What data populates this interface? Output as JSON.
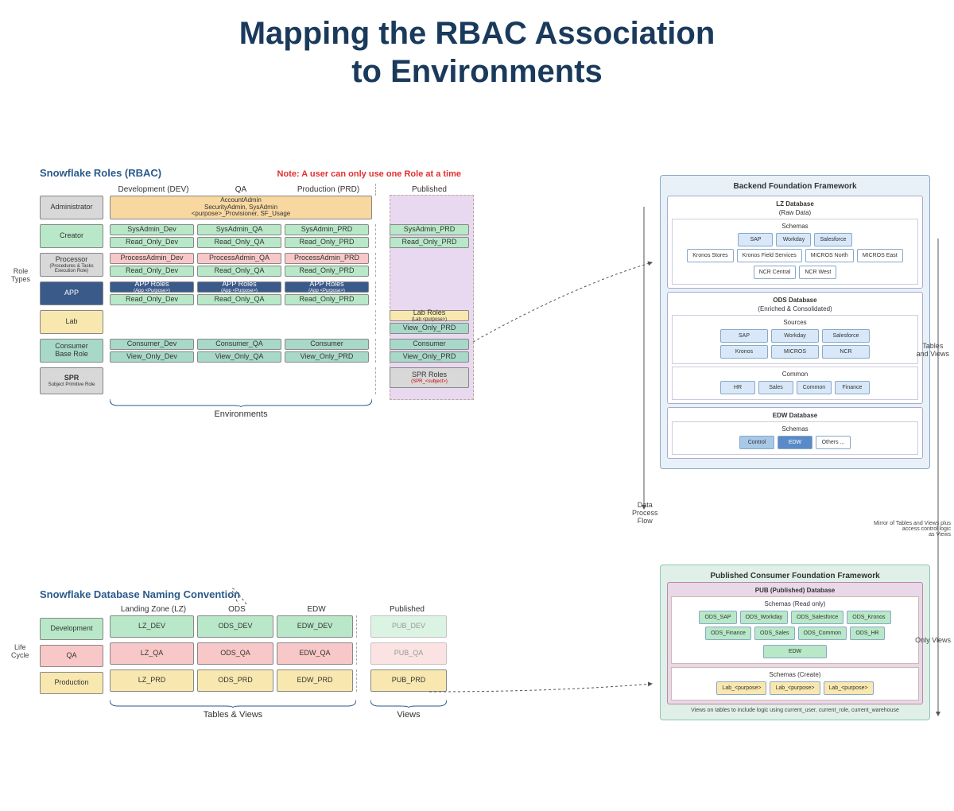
{
  "title_line1": "Mapping the RBAC Association",
  "title_line2": "to Environments",
  "rbac": {
    "header": "Snowflake Roles (RBAC)",
    "note": "Note: A user can only use one Role at a time",
    "col_dev": "Development (DEV)",
    "col_qa": "QA",
    "col_prd": "Production (PRD)",
    "col_pub": "Published",
    "role_types_label": "Role\nTypes",
    "env_label": "Environments",
    "rows": {
      "admin": "Administrator",
      "creator": "Creator",
      "processor": "Processor",
      "processor_sub": "(Procedures & Tasks Execution Role)",
      "app": "APP",
      "lab": "Lab",
      "consumer": "Consumer\nBase Role",
      "spr": "SPR",
      "spr_sub": "Subject Primitive Role"
    },
    "admin_box": "AccountAdmin\nSecurityAdmin, SysAdmin\n<purpose>_Provisioner, SF_Usage",
    "creator_dev": "SysAdmin_Dev",
    "creator_qa": "SysAdmin_QA",
    "creator_prd": "SysAdmin_PRD",
    "creator_pub": "SysAdmin_PRD",
    "creator_ro_dev": "Read_Only_Dev",
    "creator_ro_qa": "Read_Only_QA",
    "creator_ro_prd": "Read_Only_PRD",
    "creator_ro_pub": "Read_Only_PRD",
    "proc_dev": "ProcessAdmin_Dev",
    "proc_qa": "ProcessAdmin_QA",
    "proc_prd": "ProcessAdmin_PRD",
    "proc_ro_dev": "Read_Only_Dev",
    "proc_ro_qa": "Read_Only_QA",
    "proc_ro_prd": "Read_Only_PRD",
    "app_dev": "APP Roles",
    "app_dev_sub": "(App <Purpose>)",
    "app_qa": "APP Roles",
    "app_prd": "APP Roles",
    "app_ro_dev": "Read_Only_Dev",
    "app_ro_qa": "Read_Only_QA",
    "app_ro_prd": "Read_Only_PRD",
    "lab_pub": "Lab Roles",
    "lab_pub_sub": "(Lab <purpose>)",
    "lab_vo_pub": "View_Only_PRD",
    "cons_dev": "Consumer_Dev",
    "cons_qa": "Consumer_QA",
    "cons_prd": "Consumer",
    "cons_pub": "Consumer",
    "cons_vo_dev": "View_Only_Dev",
    "cons_vo_qa": "View_Only_QA",
    "cons_vo_prd": "View_Only_PRD",
    "cons_vo_pub": "View_Only_PRD",
    "spr_pub": "SPR Roles",
    "spr_pub_sub": "(SPR_<subject>)"
  },
  "naming": {
    "header": "Snowflake Database Naming Convention",
    "col_lz": "Landing Zone (LZ)",
    "col_ods": "ODS",
    "col_edw": "EDW",
    "col_pub": "Published",
    "life_label": "Life\nCycle",
    "rows": {
      "dev": "Development",
      "qa": "QA",
      "prd": "Production"
    },
    "lz_dev": "LZ_DEV",
    "lz_qa": "LZ_QA",
    "lz_prd": "LZ_PRD",
    "ods_dev": "ODS_DEV",
    "ods_qa": "ODS_QA",
    "ods_prd": "ODS_PRD",
    "edw_dev": "EDW_DEV",
    "edw_qa": "EDW_QA",
    "edw_prd": "EDW_PRD",
    "pub_dev": "PUB_DEV",
    "pub_qa": "PUB_QA",
    "pub_prd": "PUB_PRD",
    "tables_views": "Tables & Views",
    "views": "Views"
  },
  "backend": {
    "title": "Backend Foundation Framework",
    "lz_db": "LZ  Database",
    "raw": "(Raw Data)",
    "schemas": "Schemas",
    "sap": "SAP",
    "workday": "Workday",
    "salesforce": "Salesforce",
    "kronos_stores": "Kronos Stores",
    "kronos_field": "Kronos Field Services",
    "micros_north": "MICROS North",
    "micros_east": "MICROS East",
    "ncr_central": "NCR Central",
    "ncr_west": "NCR West",
    "ods_db": "ODS Database",
    "ods_sub": "(Enriched & Consolidated)",
    "sources": "Sources",
    "kronos": "Kronos",
    "micros": "MICROS",
    "ncr": "NCR",
    "common": "Common",
    "hr": "HR",
    "sales": "Sales",
    "common_b": "Common",
    "finance": "Finance",
    "edw_db": "EDW Database",
    "control": "Control",
    "edw": "EDW",
    "others": "Others ...",
    "flow": "Data\nProcess\nFlow",
    "tv_label": "Tables\nand Views",
    "mirror": "Mirror of Tables and Views plus\naccess control logic\nas Views"
  },
  "pub": {
    "title": "Published Consumer Foundation Framework",
    "pub_db": "PUB (Published) Database",
    "schemas_ro": "Schemas (Read only)",
    "ods_sap": "ODS_SAP",
    "ods_workday": "ODS_Workday",
    "ods_sf": "ODS_Salesforce",
    "ods_kronos": "ODS_Kronos",
    "ods_finance": "ODS_Finance",
    "ods_sales": "ODS_Sales",
    "ods_common": "ODS_Common",
    "ods_hr": "ODS_HR",
    "edw": "EDW",
    "schemas_create": "Schemas (Create)",
    "lab1": "Lab_<purpose>",
    "lab2": "Lab_<purpose>",
    "lab3": "Lab_<purpose>",
    "only_views": "Only Views",
    "footer": "Views on tables to include logic using current_user, current_role, current_warehouse"
  }
}
